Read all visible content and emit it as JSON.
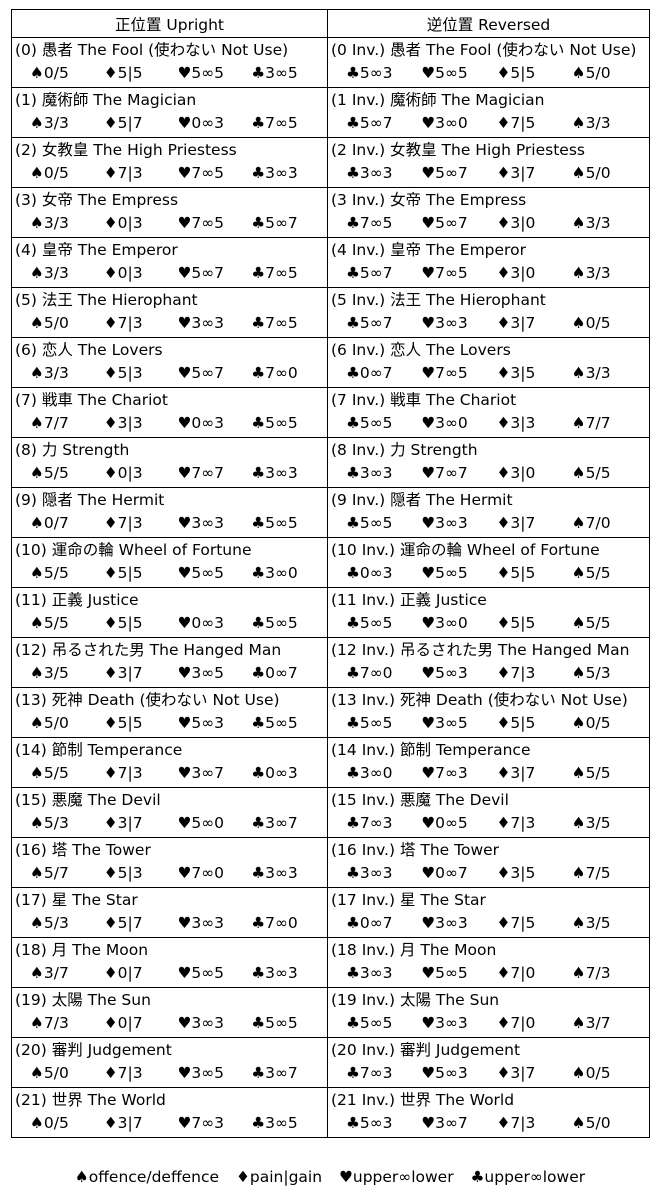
{
  "headers": {
    "upright": "正位置 Upright",
    "reversed": "逆位置 Reversed"
  },
  "rows": [
    {
      "up": {
        "name": "(0) 愚者 The Fool (使わない Not Use)",
        "s": [
          "♠0/5",
          "♦5|5",
          "♥5∞5",
          "♣3∞5"
        ]
      },
      "rev": {
        "name": "(0 Inv.) 愚者 The Fool (使わない Not Use)",
        "s": [
          "♣5∞3",
          "♥5∞5",
          "♦5|5",
          "♠5/0"
        ]
      }
    },
    {
      "up": {
        "name": "(1) 魔術師 The Magician",
        "s": [
          "♠3/3",
          "♦5|7",
          "♥0∞3",
          "♣7∞5"
        ]
      },
      "rev": {
        "name": "(1 Inv.) 魔術師 The Magician",
        "s": [
          "♣5∞7",
          "♥3∞0",
          "♦7|5",
          "♠3/3"
        ]
      }
    },
    {
      "up": {
        "name": "(2) 女教皇 The High Priestess",
        "s": [
          "♠0/5",
          "♦7|3",
          "♥7∞5",
          "♣3∞3"
        ]
      },
      "rev": {
        "name": "(2 Inv.) 女教皇 The High Priestess",
        "s": [
          "♣3∞3",
          "♥5∞7",
          "♦3|7",
          "♠5/0"
        ]
      }
    },
    {
      "up": {
        "name": "(3) 女帝 The Empress",
        "s": [
          "♠3/3",
          "♦0|3",
          "♥7∞5",
          "♣5∞7"
        ]
      },
      "rev": {
        "name": "(3 Inv.) 女帝 The Empress",
        "s": [
          "♣7∞5",
          "♥5∞7",
          "♦3|0",
          "♠3/3"
        ]
      }
    },
    {
      "up": {
        "name": "(4) 皇帝 The Emperor",
        "s": [
          "♠3/3",
          "♦0|3",
          "♥5∞7",
          "♣7∞5"
        ]
      },
      "rev": {
        "name": "(4 Inv.) 皇帝 The Emperor",
        "s": [
          "♣5∞7",
          "♥7∞5",
          "♦3|0",
          "♠3/3"
        ]
      }
    },
    {
      "up": {
        "name": "(5) 法王 The Hierophant",
        "s": [
          "♠5/0",
          "♦7|3",
          "♥3∞3",
          "♣7∞5"
        ]
      },
      "rev": {
        "name": "(5 Inv.) 法王 The Hierophant",
        "s": [
          "♣5∞7",
          "♥3∞3",
          "♦3|7",
          "♠0/5"
        ]
      }
    },
    {
      "up": {
        "name": "(6) 恋人 The Lovers",
        "s": [
          "♠3/3",
          "♦5|3",
          "♥5∞7",
          "♣7∞0"
        ]
      },
      "rev": {
        "name": "(6 Inv.) 恋人 The Lovers",
        "s": [
          "♣0∞7",
          "♥7∞5",
          "♦3|5",
          "♠3/3"
        ]
      }
    },
    {
      "up": {
        "name": "(7) 戦車 The Chariot",
        "s": [
          "♠7/7",
          "♦3|3",
          "♥0∞3",
          "♣5∞5"
        ]
      },
      "rev": {
        "name": "(7 Inv.) 戦車 The Chariot",
        "s": [
          "♣5∞5",
          "♥3∞0",
          "♦3|3",
          "♠7/7"
        ]
      }
    },
    {
      "up": {
        "name": "(8) 力 Strength",
        "s": [
          "♠5/5",
          "♦0|3",
          "♥7∞7",
          "♣3∞3"
        ]
      },
      "rev": {
        "name": "(8 Inv.) 力 Strength",
        "s": [
          "♣3∞3",
          "♥7∞7",
          "♦3|0",
          "♠5/5"
        ]
      }
    },
    {
      "up": {
        "name": "(9) 隠者 The Hermit",
        "s": [
          "♠0/7",
          "♦7|3",
          "♥3∞3",
          "♣5∞5"
        ]
      },
      "rev": {
        "name": "(9 Inv.) 隠者 The Hermit",
        "s": [
          "♣5∞5",
          "♥3∞3",
          "♦3|7",
          "♠7/0"
        ]
      }
    },
    {
      "up": {
        "name": "(10) 運命の輪 Wheel of Fortune",
        "s": [
          "♠5/5",
          "♦5|5",
          "♥5∞5",
          "♣3∞0"
        ]
      },
      "rev": {
        "name": "(10 Inv.) 運命の輪 Wheel of Fortune",
        "s": [
          "♣0∞3",
          "♥5∞5",
          "♦5|5",
          "♠5/5"
        ]
      }
    },
    {
      "up": {
        "name": "(11) 正義 Justice",
        "s": [
          "♠5/5",
          "♦5|5",
          "♥0∞3",
          "♣5∞5"
        ]
      },
      "rev": {
        "name": "(11 Inv.) 正義 Justice",
        "s": [
          "♣5∞5",
          "♥3∞0",
          "♦5|5",
          "♠5/5"
        ]
      }
    },
    {
      "up": {
        "name": "(12) 吊るされた男 The Hanged Man",
        "s": [
          "♠3/5",
          "♦3|7",
          "♥3∞5",
          "♣0∞7"
        ]
      },
      "rev": {
        "name": "(12 Inv.) 吊るされた男 The Hanged Man",
        "s": [
          "♣7∞0",
          "♥5∞3",
          "♦7|3",
          "♠5/3"
        ]
      }
    },
    {
      "up": {
        "name": "(13) 死神 Death (使わない Not Use)",
        "s": [
          "♠5/0",
          "♦5|5",
          "♥5∞3",
          "♣5∞5"
        ]
      },
      "rev": {
        "name": "(13 Inv.) 死神 Death (使わない Not Use)",
        "s": [
          "♣5∞5",
          "♥3∞5",
          "♦5|5",
          "♠0/5"
        ]
      }
    },
    {
      "up": {
        "name": "(14) 節制 Temperance",
        "s": [
          "♠5/5",
          "♦7|3",
          "♥3∞7",
          "♣0∞3"
        ]
      },
      "rev": {
        "name": "(14 Inv.) 節制 Temperance",
        "s": [
          "♣3∞0",
          "♥7∞3",
          "♦3|7",
          "♠5/5"
        ]
      }
    },
    {
      "up": {
        "name": "(15) 悪魔 The Devil",
        "s": [
          "♠5/3",
          "♦3|7",
          "♥5∞0",
          "♣3∞7"
        ]
      },
      "rev": {
        "name": "(15 Inv.) 悪魔 The Devil",
        "s": [
          "♣7∞3",
          "♥0∞5",
          "♦7|3",
          "♠3/5"
        ]
      }
    },
    {
      "up": {
        "name": "(16) 塔 The Tower",
        "s": [
          "♠5/7",
          "♦5|3",
          "♥7∞0",
          "♣3∞3"
        ]
      },
      "rev": {
        "name": "(16 Inv.) 塔 The Tower",
        "s": [
          "♣3∞3",
          "♥0∞7",
          "♦3|5",
          "♠7/5"
        ]
      }
    },
    {
      "up": {
        "name": "(17) 星 The Star",
        "s": [
          "♠5/3",
          "♦5|7",
          "♥3∞3",
          "♣7∞0"
        ]
      },
      "rev": {
        "name": "(17 Inv.) 星 The Star",
        "s": [
          "♣0∞7",
          "♥3∞3",
          "♦7|5",
          "♠3/5"
        ]
      }
    },
    {
      "up": {
        "name": "(18) 月 The Moon",
        "s": [
          "♠3/7",
          "♦0|7",
          "♥5∞5",
          "♣3∞3"
        ]
      },
      "rev": {
        "name": "(18 Inv.) 月 The Moon",
        "s": [
          "♣3∞3",
          "♥5∞5",
          "♦7|0",
          "♠7/3"
        ]
      }
    },
    {
      "up": {
        "name": "(19) 太陽 The Sun",
        "s": [
          "♠7/3",
          "♦0|7",
          "♥3∞3",
          "♣5∞5"
        ]
      },
      "rev": {
        "name": "(19 Inv.) 太陽 The Sun",
        "s": [
          "♣5∞5",
          "♥3∞3",
          "♦7|0",
          "♠3/7"
        ]
      }
    },
    {
      "up": {
        "name": "(20) 審判 Judgement",
        "s": [
          "♠5/0",
          "♦7|3",
          "♥3∞5",
          "♣3∞7"
        ]
      },
      "rev": {
        "name": "(20 Inv.) 審判 Judgement",
        "s": [
          "♣7∞3",
          "♥5∞3",
          "♦3|7",
          "♠0/5"
        ]
      }
    },
    {
      "up": {
        "name": "(21) 世界 The World",
        "s": [
          "♠0/5",
          "♦3|7",
          "♥7∞3",
          "♣3∞5"
        ]
      },
      "rev": {
        "name": "(21 Inv.) 世界 The World",
        "s": [
          "♣5∞3",
          "♥3∞7",
          "♦7|3",
          "♠5/0"
        ]
      }
    }
  ],
  "legend": [
    "♠offence/deffence",
    "♦pain|gain",
    "♥upper∞lower",
    "♣upper∞lower"
  ]
}
